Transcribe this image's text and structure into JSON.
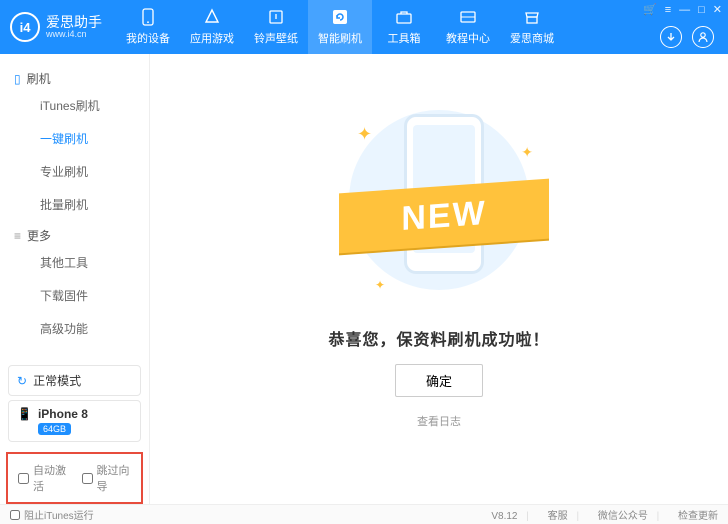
{
  "app": {
    "name": "爱思助手",
    "url": "www.i4.cn"
  },
  "nav": {
    "items": [
      {
        "label": "我的设备",
        "icon": "phone"
      },
      {
        "label": "应用游戏",
        "icon": "apps"
      },
      {
        "label": "铃声壁纸",
        "icon": "music"
      },
      {
        "label": "智能刷机",
        "icon": "refresh",
        "active": true
      },
      {
        "label": "工具箱",
        "icon": "toolbox"
      },
      {
        "label": "教程中心",
        "icon": "book"
      },
      {
        "label": "爱思商城",
        "icon": "store"
      }
    ]
  },
  "titlebar": {
    "cart": "🛒",
    "menu": "≡",
    "min": "—",
    "max": "□",
    "close": "✕"
  },
  "headerRight": {
    "download": "↓",
    "user": "◯"
  },
  "sidebar": {
    "groups": [
      {
        "title": "刷机",
        "icon": "📱",
        "items": [
          {
            "label": "iTunes刷机"
          },
          {
            "label": "一键刷机",
            "active": true
          },
          {
            "label": "专业刷机"
          },
          {
            "label": "批量刷机"
          }
        ]
      },
      {
        "title": "更多",
        "icon": "≡",
        "items": [
          {
            "label": "其他工具"
          },
          {
            "label": "下载固件"
          },
          {
            "label": "高级功能"
          }
        ]
      }
    ],
    "mode": {
      "label": "正常模式"
    },
    "device": {
      "name": "iPhone 8",
      "storage": "64GB"
    },
    "options": {
      "autoActivate": "自动激活",
      "skipWizard": "跳过向导"
    }
  },
  "main": {
    "banner": "NEW",
    "message": "恭喜您，保资料刷机成功啦！",
    "ok": "确定",
    "viewLog": "查看日志"
  },
  "footer": {
    "blockItunes": "阻止iTunes运行",
    "version": "V8.12",
    "support": "客服",
    "wechat": "微信公众号",
    "update": "检查更新"
  }
}
